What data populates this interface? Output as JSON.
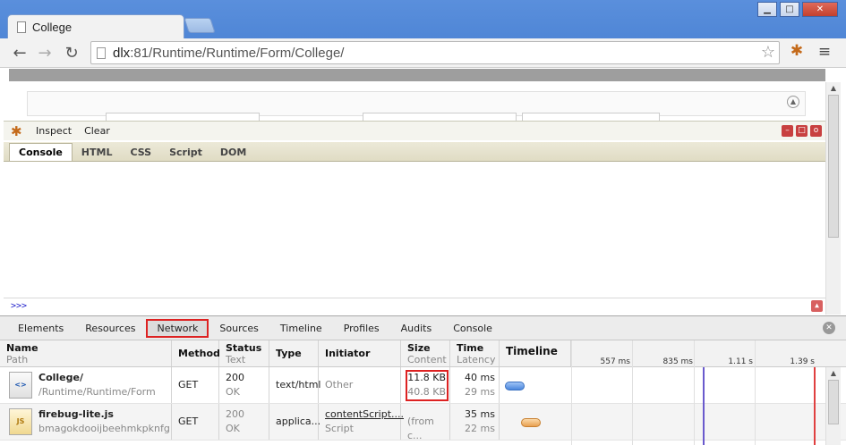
{
  "browser": {
    "tab_title": "College",
    "url_host": "dlx",
    "url_rest": ":81/Runtime/Runtime/Form/College/",
    "window_controls": [
      "minimize",
      "maximize",
      "close"
    ]
  },
  "firebug": {
    "toolbar": {
      "inspect": "Inspect",
      "clear": "Clear"
    },
    "tabs": [
      "Console",
      "HTML",
      "CSS",
      "Script",
      "DOM"
    ],
    "active_tab": "Console",
    "command_prompt": ">>>"
  },
  "devtools": {
    "tabs": [
      "Elements",
      "Resources",
      "Network",
      "Sources",
      "Timeline",
      "Profiles",
      "Audits",
      "Console"
    ],
    "selected_tab": "Network",
    "columns": {
      "name": {
        "title": "Name",
        "sub": "Path"
      },
      "method": {
        "title": "Method"
      },
      "status": {
        "title": "Status",
        "sub": "Text"
      },
      "type": {
        "title": "Type"
      },
      "initiator": {
        "title": "Initiator"
      },
      "size": {
        "title": "Size",
        "sub": "Content"
      },
      "time": {
        "title": "Time",
        "sub": "Latency"
      },
      "timeline": {
        "title": "Timeline"
      }
    },
    "timeline_ticks": [
      "557 ms",
      "835 ms",
      "1.11 s",
      "1.39 s"
    ],
    "rows": [
      {
        "name": "College/",
        "path": "/Runtime/Runtime/Form",
        "method": "GET",
        "status": "200",
        "status_text": "OK",
        "type": "text/html",
        "initiator": "Other",
        "initiator_sub": "",
        "size": "11.8 KB",
        "content": "40.8 KB",
        "time": "40 ms",
        "latency": "29 ms",
        "icon": "<>"
      },
      {
        "name": "firebug-lite.js",
        "path": "bmagokdooijbeehmkpknfg",
        "method": "GET",
        "status": "200",
        "status_text": "OK",
        "type": "applica...",
        "initiator": "contentScript....",
        "initiator_sub": "Script",
        "size": "(from c...",
        "content": "",
        "time": "35 ms",
        "latency": "22 ms",
        "icon": "JS"
      }
    ]
  },
  "colors": {
    "frame": "#4f86d6",
    "highlight": "#dd2222",
    "timeline_marker_blue": "#6a5acd",
    "timeline_marker_red": "#e04040"
  }
}
